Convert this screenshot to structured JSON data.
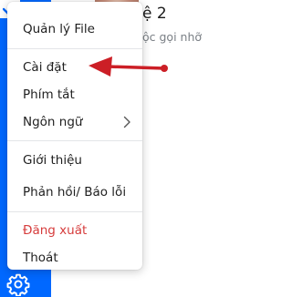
{
  "chat_preview": {
    "title": "ệ 2",
    "snippet": "ộc gọi nhỡ"
  },
  "sidebar": {
    "settings_icon": "gear-icon",
    "top_icon": "checkbox-check-icon"
  },
  "menu": {
    "items": [
      {
        "label": "Quản lý File"
      },
      {
        "label": "Cài đặt"
      },
      {
        "label": "Phím tắt"
      },
      {
        "label": "Ngôn ngữ",
        "icon": "chevron-right-icon"
      },
      {
        "label": "Giới thiệu"
      },
      {
        "label": "Phản hồi/ Báo lỗi"
      },
      {
        "label": "Đăng xuất"
      },
      {
        "label": "Thoát"
      }
    ]
  },
  "annotation": {
    "color": "#cc1f26",
    "points_to": "Cài đặt"
  },
  "colors": {
    "sidebar": "#0068ff",
    "danger_text": "#d63c3c"
  }
}
